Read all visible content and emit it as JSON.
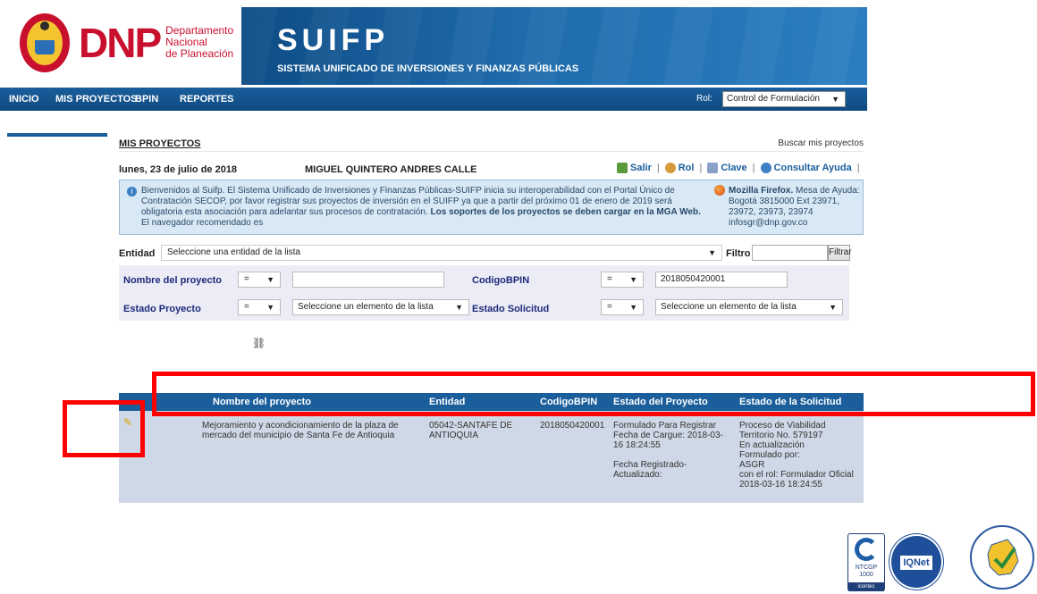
{
  "header": {
    "org_short": "DNP",
    "org_name_line1": "Departamento",
    "org_name_line2": "Nacional",
    "org_name_line3": "de Planeación",
    "app_title": "SUIFP",
    "app_subtitle": "SISTEMA UNIFICADO DE INVERSIONES Y FINANZAS PÚBLICAS"
  },
  "nav": {
    "items": [
      "INICIO",
      "MIS PROYECTOS",
      "BPIN",
      "REPORTES"
    ],
    "rol_label": "Rol:",
    "rol_value": "Control de Formulación"
  },
  "page": {
    "title": "MIS PROYECTOS",
    "search_link": "Buscar mis proyectos",
    "date": "lunes, 23 de julio de 2018",
    "user": "MIGUEL QUINTERO ANDRES CALLE",
    "actions": [
      "Salir",
      "Rol",
      "Clave",
      "Consultar Ayuda"
    ]
  },
  "info": {
    "text_part1": "Bienvenidos al Suifp. El Sistema Unificado de Inversiones y Finanzas Públicas-SUIFP inicia su interoperabilidad con el Portal Único de Contratación SECOP, por favor registrar sus proyectos de inversión en el SUIFP ya que a partir del próximo 01 de enero de 2019 será obligatoria esta asociación para adelantar sus procesos de contratación.",
    "text_bold": "Los soportes de los proyectos se deben cargar en la MGA Web.",
    "text_part2": "El navegador recomendado es",
    "browser_bold": "Mozilla Firefox.",
    "help_text": "Mesa de Ayuda: Bogotá 3815000 Ext 23971, 23972, 23973, 23974 infosgr@dnp.gov.co"
  },
  "filters": {
    "entidad_label": "Entidad",
    "entidad_placeholder": "Seleccione una entidad de la lista",
    "filtro_label": "Filtro",
    "filtrar_button": "Filtrar",
    "nombre_label": "Nombre del proyecto",
    "codigo_label": "CodigoBPIN",
    "estado_proyecto_label": "Estado Proyecto",
    "estado_solicitud_label": "Estado Solicitud",
    "operator": "=",
    "codigo_value": "2018050420001",
    "select_placeholder": "Seleccione un elemento de la lista"
  },
  "table": {
    "headers": [
      "Nombre del proyecto",
      "Entidad",
      "CodigoBPIN",
      "Estado del Proyecto",
      "Estado de la Solicitud"
    ],
    "rows": [
      {
        "nombre": "Mejoramiento y acondicionamiento de la plaza de mercado del municipio de Santa Fe de Antioquia",
        "entidad": "05042-SANTAFE DE ANTIOQUIA",
        "codigo": "2018050420001",
        "estado_proyecto": "Formulado Para Registrar\nFecha de Cargue: 2018-03-16 18:24:55\n\nFecha Registrado-Actualizado:",
        "estado_solicitud": "Proceso de Viabilidad Territorio No. 579197\nEn actualización\nFormulado por:\nASGR\ncon el rol: Formulador Oficial\n2018-03-16 18:24:55"
      }
    ]
  },
  "footer": {
    "cert1": "NTCGP 1000",
    "cert1_sub": "icontec",
    "cert2": "IQNet"
  },
  "colors": {
    "brand_red": "#c8102e",
    "nav_blue": "#1a5e9c",
    "annotation_red": "#ff0000"
  }
}
